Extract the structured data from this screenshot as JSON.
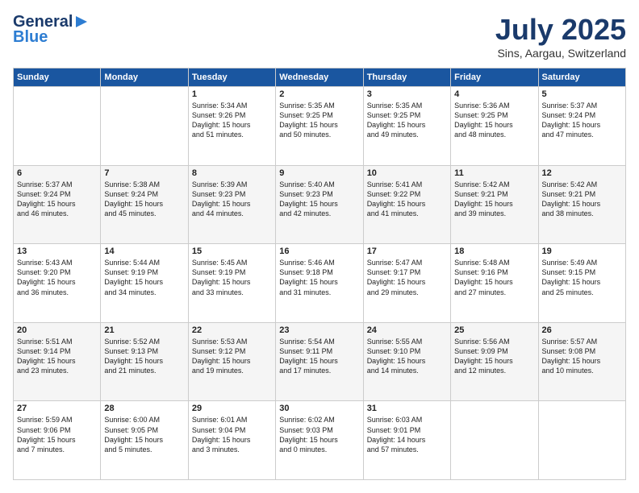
{
  "header": {
    "logo_line1": "General",
    "logo_line2": "Blue",
    "month": "July 2025",
    "location": "Sins, Aargau, Switzerland"
  },
  "weekdays": [
    "Sunday",
    "Monday",
    "Tuesday",
    "Wednesday",
    "Thursday",
    "Friday",
    "Saturday"
  ],
  "weeks": [
    [
      {
        "day": "",
        "text": ""
      },
      {
        "day": "",
        "text": ""
      },
      {
        "day": "1",
        "text": "Sunrise: 5:34 AM\nSunset: 9:26 PM\nDaylight: 15 hours\nand 51 minutes."
      },
      {
        "day": "2",
        "text": "Sunrise: 5:35 AM\nSunset: 9:25 PM\nDaylight: 15 hours\nand 50 minutes."
      },
      {
        "day": "3",
        "text": "Sunrise: 5:35 AM\nSunset: 9:25 PM\nDaylight: 15 hours\nand 49 minutes."
      },
      {
        "day": "4",
        "text": "Sunrise: 5:36 AM\nSunset: 9:25 PM\nDaylight: 15 hours\nand 48 minutes."
      },
      {
        "day": "5",
        "text": "Sunrise: 5:37 AM\nSunset: 9:24 PM\nDaylight: 15 hours\nand 47 minutes."
      }
    ],
    [
      {
        "day": "6",
        "text": "Sunrise: 5:37 AM\nSunset: 9:24 PM\nDaylight: 15 hours\nand 46 minutes."
      },
      {
        "day": "7",
        "text": "Sunrise: 5:38 AM\nSunset: 9:24 PM\nDaylight: 15 hours\nand 45 minutes."
      },
      {
        "day": "8",
        "text": "Sunrise: 5:39 AM\nSunset: 9:23 PM\nDaylight: 15 hours\nand 44 minutes."
      },
      {
        "day": "9",
        "text": "Sunrise: 5:40 AM\nSunset: 9:23 PM\nDaylight: 15 hours\nand 42 minutes."
      },
      {
        "day": "10",
        "text": "Sunrise: 5:41 AM\nSunset: 9:22 PM\nDaylight: 15 hours\nand 41 minutes."
      },
      {
        "day": "11",
        "text": "Sunrise: 5:42 AM\nSunset: 9:21 PM\nDaylight: 15 hours\nand 39 minutes."
      },
      {
        "day": "12",
        "text": "Sunrise: 5:42 AM\nSunset: 9:21 PM\nDaylight: 15 hours\nand 38 minutes."
      }
    ],
    [
      {
        "day": "13",
        "text": "Sunrise: 5:43 AM\nSunset: 9:20 PM\nDaylight: 15 hours\nand 36 minutes."
      },
      {
        "day": "14",
        "text": "Sunrise: 5:44 AM\nSunset: 9:19 PM\nDaylight: 15 hours\nand 34 minutes."
      },
      {
        "day": "15",
        "text": "Sunrise: 5:45 AM\nSunset: 9:19 PM\nDaylight: 15 hours\nand 33 minutes."
      },
      {
        "day": "16",
        "text": "Sunrise: 5:46 AM\nSunset: 9:18 PM\nDaylight: 15 hours\nand 31 minutes."
      },
      {
        "day": "17",
        "text": "Sunrise: 5:47 AM\nSunset: 9:17 PM\nDaylight: 15 hours\nand 29 minutes."
      },
      {
        "day": "18",
        "text": "Sunrise: 5:48 AM\nSunset: 9:16 PM\nDaylight: 15 hours\nand 27 minutes."
      },
      {
        "day": "19",
        "text": "Sunrise: 5:49 AM\nSunset: 9:15 PM\nDaylight: 15 hours\nand 25 minutes."
      }
    ],
    [
      {
        "day": "20",
        "text": "Sunrise: 5:51 AM\nSunset: 9:14 PM\nDaylight: 15 hours\nand 23 minutes."
      },
      {
        "day": "21",
        "text": "Sunrise: 5:52 AM\nSunset: 9:13 PM\nDaylight: 15 hours\nand 21 minutes."
      },
      {
        "day": "22",
        "text": "Sunrise: 5:53 AM\nSunset: 9:12 PM\nDaylight: 15 hours\nand 19 minutes."
      },
      {
        "day": "23",
        "text": "Sunrise: 5:54 AM\nSunset: 9:11 PM\nDaylight: 15 hours\nand 17 minutes."
      },
      {
        "day": "24",
        "text": "Sunrise: 5:55 AM\nSunset: 9:10 PM\nDaylight: 15 hours\nand 14 minutes."
      },
      {
        "day": "25",
        "text": "Sunrise: 5:56 AM\nSunset: 9:09 PM\nDaylight: 15 hours\nand 12 minutes."
      },
      {
        "day": "26",
        "text": "Sunrise: 5:57 AM\nSunset: 9:08 PM\nDaylight: 15 hours\nand 10 minutes."
      }
    ],
    [
      {
        "day": "27",
        "text": "Sunrise: 5:59 AM\nSunset: 9:06 PM\nDaylight: 15 hours\nand 7 minutes."
      },
      {
        "day": "28",
        "text": "Sunrise: 6:00 AM\nSunset: 9:05 PM\nDaylight: 15 hours\nand 5 minutes."
      },
      {
        "day": "29",
        "text": "Sunrise: 6:01 AM\nSunset: 9:04 PM\nDaylight: 15 hours\nand 3 minutes."
      },
      {
        "day": "30",
        "text": "Sunrise: 6:02 AM\nSunset: 9:03 PM\nDaylight: 15 hours\nand 0 minutes."
      },
      {
        "day": "31",
        "text": "Sunrise: 6:03 AM\nSunset: 9:01 PM\nDaylight: 14 hours\nand 57 minutes."
      },
      {
        "day": "",
        "text": ""
      },
      {
        "day": "",
        "text": ""
      }
    ]
  ]
}
